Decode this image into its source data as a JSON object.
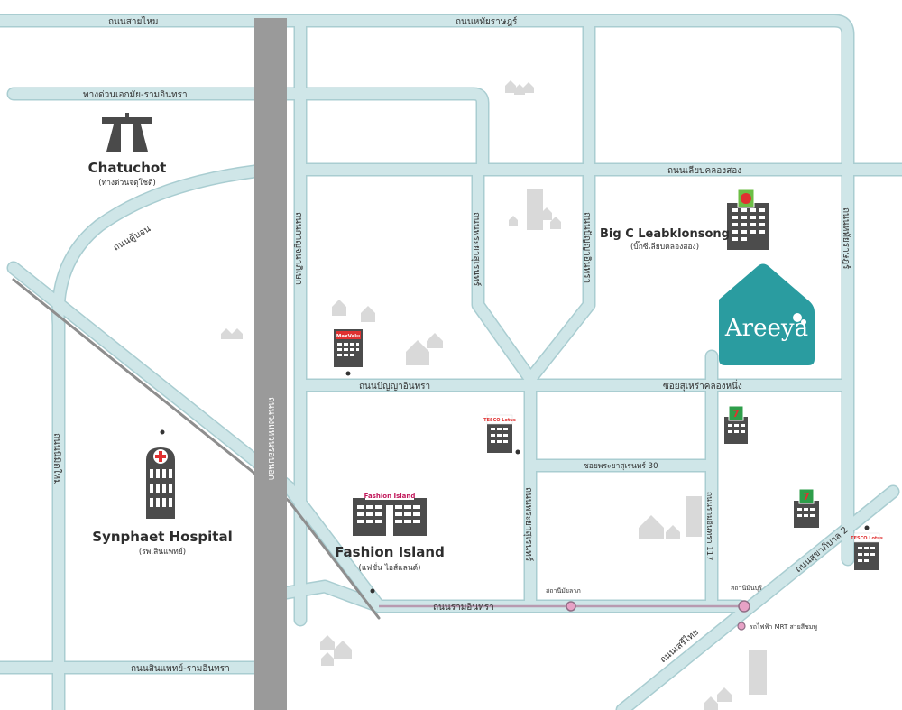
{
  "roads": {
    "sai_mai": "ถนนสายไหม",
    "hathai_rat_top": "ถนนหทัยราษฎร์",
    "ekkamai_ramintra_expressway": "ทางด่วนเอกมัย-รามอินทรา",
    "liap_khlong_song": "ถนนเลียบคลองสอง",
    "khu_bon": "ถนนคู้บอน",
    "kanchanaphisek": "ถนนกาญจนาภิเษก",
    "outer_ring": "ถนนวงแหวนรอบนอก",
    "phraya_suren": "ถนนพระยาสุเรนทร์",
    "panya_intra_v": "ถนนปัญญาอินทรา",
    "hathai_rat_right": "ถนนหทัยราษฎร์",
    "panya_intra_h": "ถนนปัญญาอินทรา",
    "soi_suhreh_khlong_nueng": "ซอยสุเหร่าคลองหนึ่ง",
    "soi_phraya_suren_30": "ซอยพระยาสุเรนทร์ 30",
    "phraya_suren_2": "ถนนพระยาสุเรนทร์",
    "ramintra_117": "ถนนรามอินทรา 117",
    "ramintra": "ถนนรามอินทรา",
    "sukhaphiban_2": "ถนนสุขาภิบาล 2",
    "nimit_mai": "ถนนนิมิตใหม่",
    "sinphaet_ramintra": "ถนนสินแพทย์-รามอินทรา",
    "minburi_road": "ถนนเสรีไทย",
    "sukhumvit_right": "ถนนสุขาภิบาล 2"
  },
  "places": {
    "chatuchot": {
      "name": "Chatuchot",
      "sub": "(ทางด่วนจตุโชติ)",
      "icon": "expressway-icon"
    },
    "big_c": {
      "name": "Big C Leabklonsong",
      "sub": "(บิ๊กซีเลียบคลองสอง)",
      "icon": "big-c-building-icon"
    },
    "areeya": {
      "name": "Areeya",
      "icon": "areeya-house-logo"
    },
    "synphaet": {
      "name": "Synphaet Hospital",
      "sub": "(รพ.สินแพทย์)",
      "icon": "hospital-building-icon"
    },
    "fashion_island": {
      "name": "Fashion Island",
      "sub": "(แฟชั่น ไอส์แลนด์)",
      "logo": "Fashion Island",
      "icon": "mall-building-icon"
    },
    "maxvalu": {
      "logo": "MaxValu",
      "icon": "maxvalu-store-icon"
    },
    "tesco_1": {
      "logo": "TESCO Lotus",
      "icon": "tesco-store-icon"
    },
    "tesco_2": {
      "logo": "TESCO Lotus",
      "icon": "tesco-store-icon"
    },
    "seven_1": {
      "logo": "7",
      "icon": "seven-eleven-store-icon"
    },
    "seven_2": {
      "logo": "7",
      "icon": "seven-eleven-store-icon"
    }
  },
  "stations": {
    "station_1": "สถานีมัยลาภ",
    "station_2": "สถานีมีนบุรี"
  },
  "legend": {
    "mrt_pink_line": "รถไฟฟ้า MRT สายสีชมพู"
  },
  "colors": {
    "road_fill": "#cfe6e8",
    "road_edge": "#a9cdd1",
    "highway": "#9a9a9a",
    "pink_line": "#b89ab0",
    "station": "#e7a2c6",
    "building": "#555555",
    "areeya": "#2a9ca0",
    "hospital_red": "#e03131"
  }
}
